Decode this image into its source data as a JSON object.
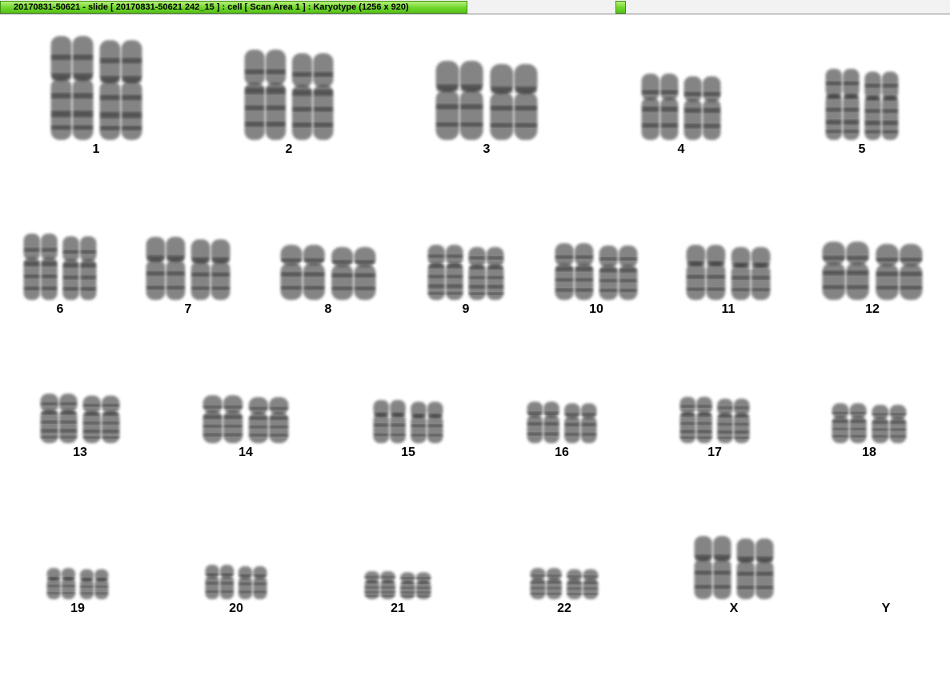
{
  "window": {
    "title": "20170831-50621 - slide [ 20170831-50621 242_15 ] : cell [ Scan Area 1 ] : Karyotype  (1256 x 920)"
  },
  "karyotype": {
    "chromosomes": [
      {
        "id": "1",
        "label": "1"
      },
      {
        "id": "2",
        "label": "2"
      },
      {
        "id": "3",
        "label": "3"
      },
      {
        "id": "4",
        "label": "4"
      },
      {
        "id": "5",
        "label": "5"
      },
      {
        "id": "6",
        "label": "6"
      },
      {
        "id": "7",
        "label": "7"
      },
      {
        "id": "8",
        "label": "8"
      },
      {
        "id": "9",
        "label": "9"
      },
      {
        "id": "10",
        "label": "10"
      },
      {
        "id": "11",
        "label": "11"
      },
      {
        "id": "12",
        "label": "12"
      },
      {
        "id": "13",
        "label": "13"
      },
      {
        "id": "14",
        "label": "14"
      },
      {
        "id": "15",
        "label": "15"
      },
      {
        "id": "16",
        "label": "16"
      },
      {
        "id": "17",
        "label": "17"
      },
      {
        "id": "18",
        "label": "18"
      },
      {
        "id": "19",
        "label": "19"
      },
      {
        "id": "20",
        "label": "20"
      },
      {
        "id": "21",
        "label": "21"
      },
      {
        "id": "22",
        "label": "22"
      },
      {
        "id": "X",
        "label": "X"
      },
      {
        "id": "Y",
        "label": "Y"
      }
    ]
  },
  "colors": {
    "title_tab": "#6fd62a",
    "chromatin": "#555555",
    "band": "#2b2b2b"
  }
}
